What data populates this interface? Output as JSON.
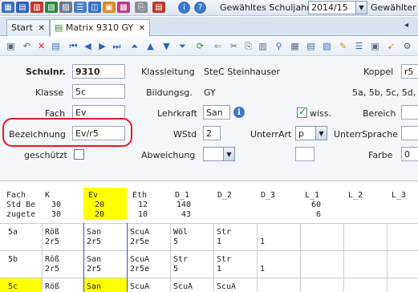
{
  "topbar": {
    "year_label": "Gewähltes Schuljahr",
    "year_value": "2014/15",
    "selected_label": "Gewählter"
  },
  "tabs": [
    {
      "label": "Start"
    },
    {
      "label": "Matrix 9310 GY"
    }
  ],
  "form": {
    "schulnr_label": "Schulnr.",
    "schulnr_value": "9310",
    "klasse_label": "Klasse",
    "klasse_value": "5c",
    "fach_label": "Fach",
    "fach_value": "Ev",
    "bezeichnung_label": "Bezeichnung",
    "bezeichnung_value": "Ev/r5",
    "geschuetzt_label": "geschützt",
    "klassleitung_label": "Klassleitung",
    "klassleitung_value": "StеC Steinhauser",
    "bildungsg_label": "Bildungsg.",
    "bildungsg_value": "GY",
    "lehrkraft_label": "Lehrkraft",
    "lehrkraft_value": "San",
    "wstd_label": "WStd",
    "wstd_value": "2",
    "abweichung_label": "Abweichung",
    "wiss_label": "wiss.",
    "unterrart_label": "UnterrArt",
    "unterrart_value": "p",
    "koppel_label": "Koppel",
    "koppel_value": "r5",
    "koppel_classes": "5a, 5b, 5c, 5d,",
    "bereich_label": "Bereich",
    "unterrsprache_label": "UnterrSprache",
    "farbe_label": "Farbe",
    "farbe_value": "0"
  },
  "matrix": {
    "row_header": [
      "Fach",
      "Std Be",
      "zugete"
    ],
    "columns": [
      {
        "name": "K",
        "std": "30",
        "zug": "30"
      },
      {
        "name": "Ev",
        "std": "20",
        "zug": "20"
      },
      {
        "name": "Eth",
        "std": "12",
        "zug": "10"
      },
      {
        "name": "D_1",
        "std": "140",
        "zug": "43"
      },
      {
        "name": "D_2",
        "std": "",
        "zug": ""
      },
      {
        "name": "D_3",
        "std": "",
        "zug": ""
      },
      {
        "name": "L_1",
        "std": "60",
        "zug": "6"
      },
      {
        "name": "L_2",
        "std": "",
        "zug": ""
      },
      {
        "name": "L_3",
        "std": "",
        "zug": ""
      }
    ],
    "rows": [
      {
        "klasse": "5a",
        "cells": [
          [
            "Röß",
            "2r5"
          ],
          [
            "San",
            "2r5"
          ],
          [
            "ScuA",
            "2r5e"
          ],
          [
            "Wöl",
            "5"
          ],
          [
            "Str",
            "1"
          ],
          [
            "",
            "1"
          ]
        ]
      },
      {
        "klasse": "5b",
        "cells": [
          [
            "Röß",
            "2r5"
          ],
          [
            "San",
            "2r5"
          ],
          [
            "ScuA",
            "2r5e"
          ],
          [
            "Str",
            "5"
          ],
          [
            "Str",
            "1"
          ],
          [
            "",
            "1"
          ]
        ]
      },
      {
        "klasse": "5c",
        "cells": [
          [
            "Röß",
            ""
          ],
          [
            "San",
            ""
          ],
          [
            "ScuA",
            ""
          ],
          [
            "ScuA",
            ""
          ],
          [
            "ScuA",
            ""
          ],
          [
            "",
            ""
          ]
        ]
      }
    ]
  },
  "colors": {
    "highlight": "#ffff00",
    "annotation_red": "#e01d2a",
    "tab_bg": "#d9e3f0"
  }
}
